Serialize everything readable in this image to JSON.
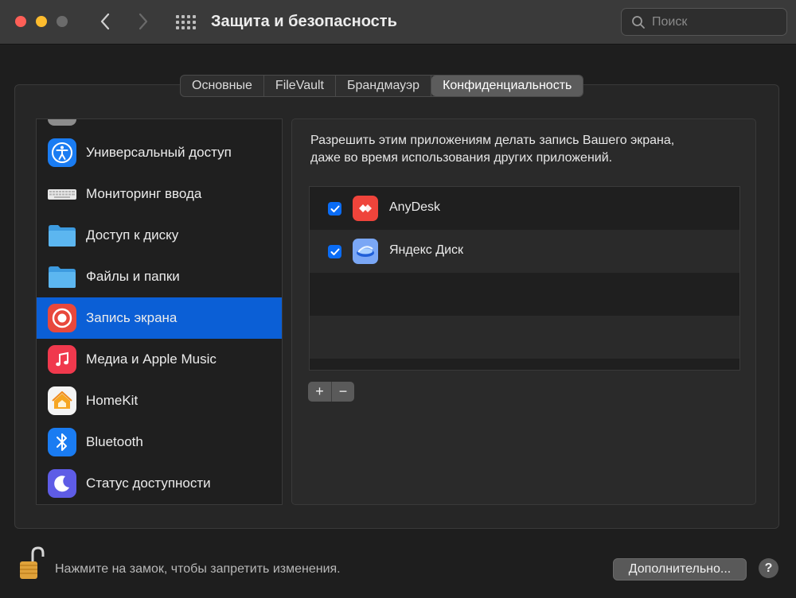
{
  "window": {
    "title": "Защита и безопасность",
    "search_placeholder": "Поиск"
  },
  "tabs": [
    {
      "label": "Основные",
      "active": false
    },
    {
      "label": "FileVault",
      "active": false
    },
    {
      "label": "Брандмауэр",
      "active": false
    },
    {
      "label": "Конфиденциальность",
      "active": true
    }
  ],
  "sidebar": {
    "items": [
      {
        "label": "Универсальный доступ",
        "icon": "accessibility-icon",
        "selected": false
      },
      {
        "label": "Мониторинг ввода",
        "icon": "keyboard-icon",
        "selected": false
      },
      {
        "label": "Доступ к диску",
        "icon": "folder-icon",
        "selected": false
      },
      {
        "label": "Файлы и папки",
        "icon": "folder-icon",
        "selected": false
      },
      {
        "label": "Запись экрана",
        "icon": "screen-record-icon",
        "selected": true
      },
      {
        "label": "Медиа и Apple Music",
        "icon": "music-icon",
        "selected": false
      },
      {
        "label": "HomeKit",
        "icon": "home-icon",
        "selected": false
      },
      {
        "label": "Bluetooth",
        "icon": "bluetooth-icon",
        "selected": false
      },
      {
        "label": "Статус доступности",
        "icon": "moon-icon",
        "selected": false
      }
    ]
  },
  "detail": {
    "description_line1": "Разрешить этим приложениям делать запись Вашего экрана,",
    "description_line2": "даже во время использования других приложений.",
    "apps": [
      {
        "name": "AnyDesk",
        "checked": true,
        "icon": "anydesk-icon"
      },
      {
        "name": "Яндекс Диск",
        "checked": true,
        "icon": "yandex-disk-icon"
      }
    ],
    "add_label": "+",
    "remove_label": "−"
  },
  "footer": {
    "lock_text": "Нажмите на замок, чтобы запретить изменения.",
    "advanced_label": "Дополнительно...",
    "help_label": "?"
  },
  "colors": {
    "accent": "#0b5fd6",
    "checkbox": "#0a6cf5"
  }
}
